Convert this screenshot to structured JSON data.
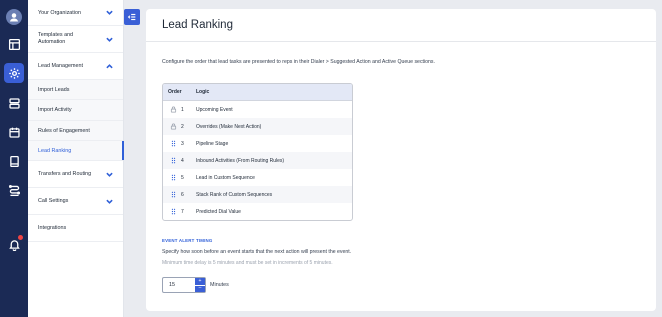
{
  "colors": {
    "rail": "#1b2a55",
    "accent": "#2f5fd8",
    "table_header": "#e3e8f6"
  },
  "rail": {
    "icons": [
      "avatar-icon",
      "layout-icon",
      "gear-icon",
      "database-icon",
      "calendar-icon",
      "book-icon",
      "route-icon",
      "bell-icon"
    ]
  },
  "menu": {
    "your_org": "Your Organization",
    "templates_line1": "Templates and",
    "templates_line2": "Automation",
    "lead_mgmt": "Lead Management",
    "import_leads": "Import Leads",
    "import_activity": "Import Activity",
    "rules": "Rules of Engagement",
    "lead_ranking": "Lead Ranking",
    "transfers": "Transfers and Routing",
    "call_settings": "Call Settings",
    "integrations": "Integrations"
  },
  "page": {
    "title": "Lead Ranking",
    "description": "Configure the order that lead tasks are presented to reps in their Dialer > Suggested Action and Active Queue sections."
  },
  "table": {
    "headers": {
      "order": "Order",
      "logic": "Logic"
    },
    "rows": [
      {
        "order": "1",
        "logic": "Upcoming Event",
        "icon": "lock-icon"
      },
      {
        "order": "2",
        "logic": "Overrides (Make Next Action)",
        "icon": "lock-icon"
      },
      {
        "order": "3",
        "logic": "Pipeline Stage",
        "icon": "drag-handle-icon"
      },
      {
        "order": "4",
        "logic": "Inbound Activities (From Routing Rules)",
        "icon": "drag-handle-icon"
      },
      {
        "order": "5",
        "logic": "Lead in Custom Sequence",
        "icon": "drag-handle-icon"
      },
      {
        "order": "6",
        "logic": "Stack Rank of Custom Sequences",
        "icon": "drag-handle-icon"
      },
      {
        "order": "7",
        "logic": "Predicted Dial Value",
        "icon": "drag-handle-icon"
      }
    ]
  },
  "event_alert": {
    "label": "EVENT ALERT TIMING",
    "description": "Specify how soon before an event starts that the next action will present the event.",
    "hint": "Minimum time delay is 5 minutes and must be set in increments of 5 minutes.",
    "value": "15",
    "increment": "+",
    "decrement": "–",
    "unit": "Minutes"
  }
}
